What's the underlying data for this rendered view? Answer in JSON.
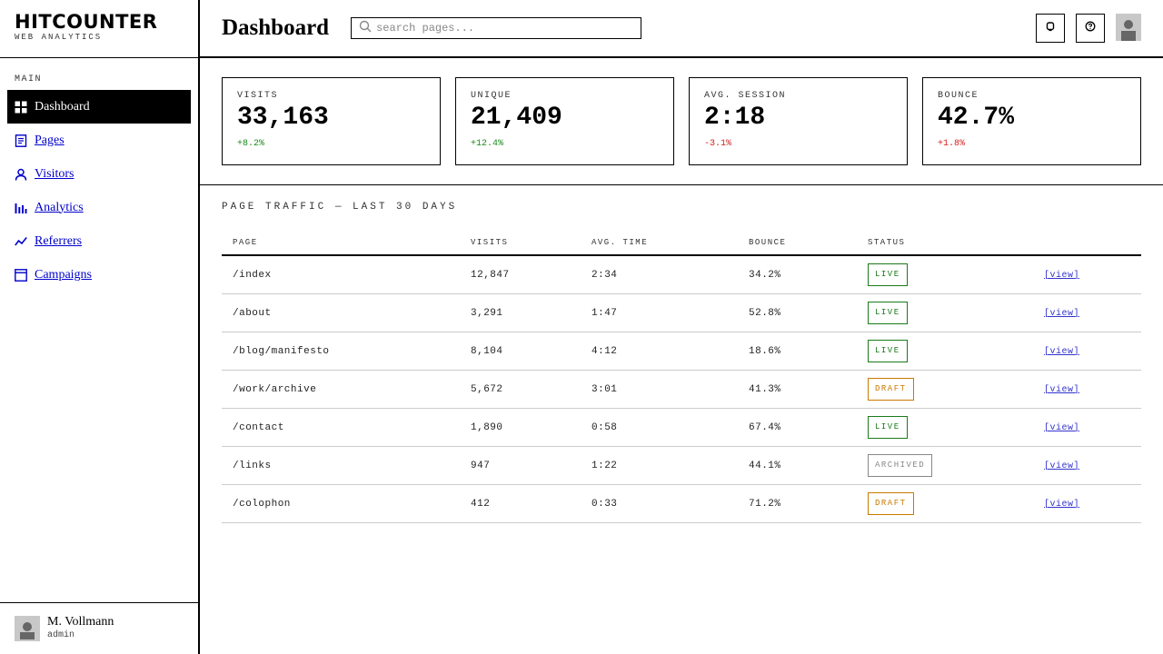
{
  "brand": {
    "title": "HITCOUNTER",
    "subtitle": "WEB ANALYTICS"
  },
  "sidebar": {
    "section_label": "MAIN",
    "items": [
      {
        "label": "Dashboard",
        "icon": "grid-icon",
        "active": true
      },
      {
        "label": "Pages",
        "icon": "document-icon",
        "active": false
      },
      {
        "label": "Visitors",
        "icon": "user-icon",
        "active": false
      },
      {
        "label": "Analytics",
        "icon": "bar-chart-icon",
        "active": false
      },
      {
        "label": "Referrers",
        "icon": "trend-line-icon",
        "active": false
      },
      {
        "label": "Campaigns",
        "icon": "window-icon",
        "active": false
      }
    ],
    "user": {
      "name": "M. Vollmann",
      "role": "admin"
    }
  },
  "header": {
    "title": "Dashboard",
    "search_placeholder": "search pages...",
    "actions": [
      {
        "icon": "bell-icon"
      },
      {
        "icon": "help-icon"
      }
    ]
  },
  "stats": [
    {
      "label": "VISITS",
      "value": "33,163",
      "delta": "+8.2%",
      "trend": "pos"
    },
    {
      "label": "UNIQUE",
      "value": "21,409",
      "delta": "+12.4%",
      "trend": "pos"
    },
    {
      "label": "AVG. SESSION",
      "value": "2:18",
      "delta": "-3.1%",
      "trend": "neg"
    },
    {
      "label": "BOUNCE",
      "value": "42.7%",
      "delta": "+1.8%",
      "trend": "neg"
    }
  ],
  "table": {
    "title": "PAGE TRAFFIC — LAST 30 DAYS",
    "columns": [
      "PAGE",
      "VISITS",
      "AVG. TIME",
      "BOUNCE",
      "STATUS"
    ],
    "action_label": "[view]",
    "rows": [
      {
        "page": "/index",
        "visits": "12,847",
        "time": "2:34",
        "bounce": "34.2%",
        "status": "LIVE"
      },
      {
        "page": "/about",
        "visits": "3,291",
        "time": "1:47",
        "bounce": "52.8%",
        "status": "LIVE"
      },
      {
        "page": "/blog/manifesto",
        "visits": "8,104",
        "time": "4:12",
        "bounce": "18.6%",
        "status": "LIVE"
      },
      {
        "page": "/work/archive",
        "visits": "5,672",
        "time": "3:01",
        "bounce": "41.3%",
        "status": "DRAFT"
      },
      {
        "page": "/contact",
        "visits": "1,890",
        "time": "0:58",
        "bounce": "67.4%",
        "status": "LIVE"
      },
      {
        "page": "/links",
        "visits": "947",
        "time": "1:22",
        "bounce": "44.1%",
        "status": "ARCHIVED"
      },
      {
        "page": "/colophon",
        "visits": "412",
        "time": "0:33",
        "bounce": "71.2%",
        "status": "DRAFT"
      }
    ]
  },
  "colors": {
    "positive": "#1a8a1a",
    "negative": "#d42020",
    "live": "#1a7a1a",
    "draft": "#c97a00",
    "archived": "#888888",
    "link": "#0000cc"
  }
}
